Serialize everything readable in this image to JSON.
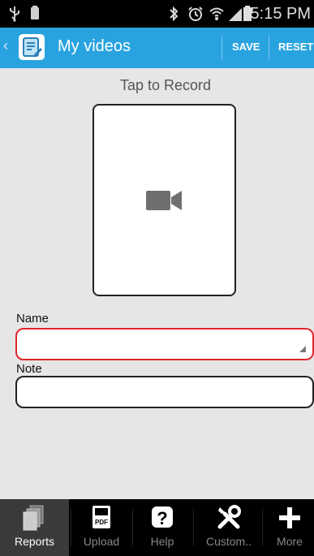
{
  "status_bar": {
    "time": "5:15 PM",
    "icons": [
      "usb-icon",
      "battery-small-icon",
      "bluetooth-icon",
      "alarm-icon",
      "wifi-icon",
      "signal-icon",
      "battery-icon"
    ]
  },
  "action_bar": {
    "title": "My videos",
    "save_label": "SAVE",
    "reset_label": "RESET",
    "color": "#29a3e0"
  },
  "content": {
    "tap_label": "Tap to Record",
    "name_label": "Name",
    "name_value": "",
    "note_label": "Note",
    "note_value": ""
  },
  "bottom_nav": {
    "items": [
      {
        "label": "Reports",
        "icon": "reports-icon",
        "active": true
      },
      {
        "label": "Upload",
        "icon": "pdf-icon",
        "active": false
      },
      {
        "label": "Help",
        "icon": "help-icon",
        "active": false
      },
      {
        "label": "Custom..",
        "icon": "tools-icon",
        "active": false
      },
      {
        "label": "More",
        "icon": "plus-icon",
        "active": false
      }
    ]
  }
}
